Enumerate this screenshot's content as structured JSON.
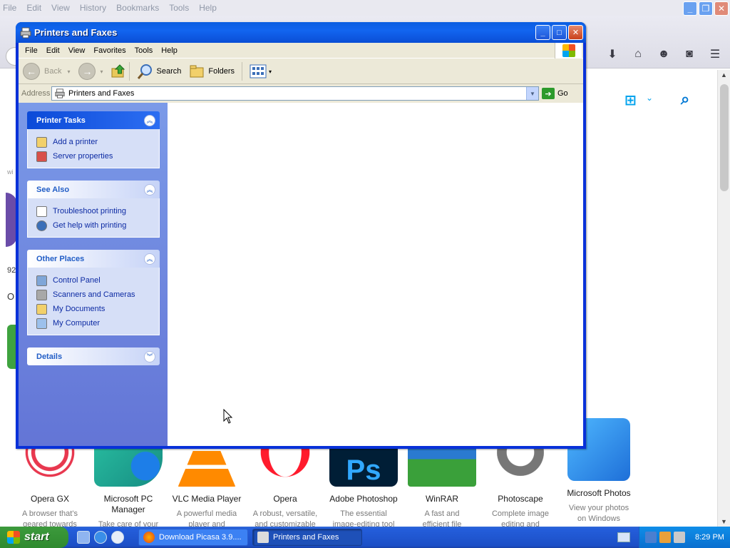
{
  "firefox": {
    "menu": [
      "File",
      "Edit",
      "View",
      "History",
      "Bookmarks",
      "Tools",
      "Help"
    ],
    "partial_texts": [
      "wi",
      "92",
      "O"
    ],
    "apps": [
      {
        "name": "Opera GX",
        "desc": [
          "A browser that's",
          "geared towards"
        ],
        "color": "#e8384f"
      },
      {
        "name": "Microsoft PC Manager",
        "desc": [
          "Take care of your"
        ],
        "color": "#1aa7a1"
      },
      {
        "name": "VLC Media Player",
        "desc": [
          "A powerful media",
          "player and"
        ],
        "color": "#f08a00"
      },
      {
        "name": "Opera",
        "desc": [
          "A robust, versatile,",
          "and customizable"
        ],
        "color": "#ff1b2d"
      },
      {
        "name": "Adobe Photoshop",
        "desc": [
          "The essential",
          "image-editing tool"
        ],
        "color": "#31a8ff"
      },
      {
        "name": "WinRAR",
        "desc": [
          "A fast and",
          "efficient file"
        ],
        "color": "#8a3c9a"
      },
      {
        "name": "Photoscape",
        "desc": [
          "Complete image",
          "editing and"
        ],
        "color": "#777777"
      },
      {
        "name": "Microsoft Photos",
        "desc": [
          "View your photos",
          "on Windows"
        ],
        "color": "#3aa0f0"
      }
    ]
  },
  "explorer": {
    "title": "Printers and Faxes",
    "menu": [
      "File",
      "Edit",
      "View",
      "Favorites",
      "Tools",
      "Help"
    ],
    "toolbar": {
      "back": "Back",
      "search": "Search",
      "folders": "Folders"
    },
    "address": {
      "label": "Address",
      "value": "Printers and Faxes",
      "go": "Go"
    },
    "panels": [
      {
        "title": "Printer Tasks",
        "items": [
          "Add a printer",
          "Server properties"
        ]
      },
      {
        "title": "See Also",
        "items": [
          "Troubleshoot printing",
          "Get help with printing"
        ]
      },
      {
        "title": "Other Places",
        "items": [
          "Control Panel",
          "Scanners and Cameras",
          "My Documents",
          "My Computer"
        ]
      },
      {
        "title": "Details",
        "items": []
      }
    ]
  },
  "taskbar": {
    "start": "start",
    "tasks": [
      "Download Picasa 3.9....",
      "Printers and Faxes"
    ],
    "clock": "8:29 PM"
  },
  "colors": {
    "xp_blue": "#0831d9",
    "task_pane": "#7b9ae8",
    "start_green": "#3c9a3c"
  }
}
